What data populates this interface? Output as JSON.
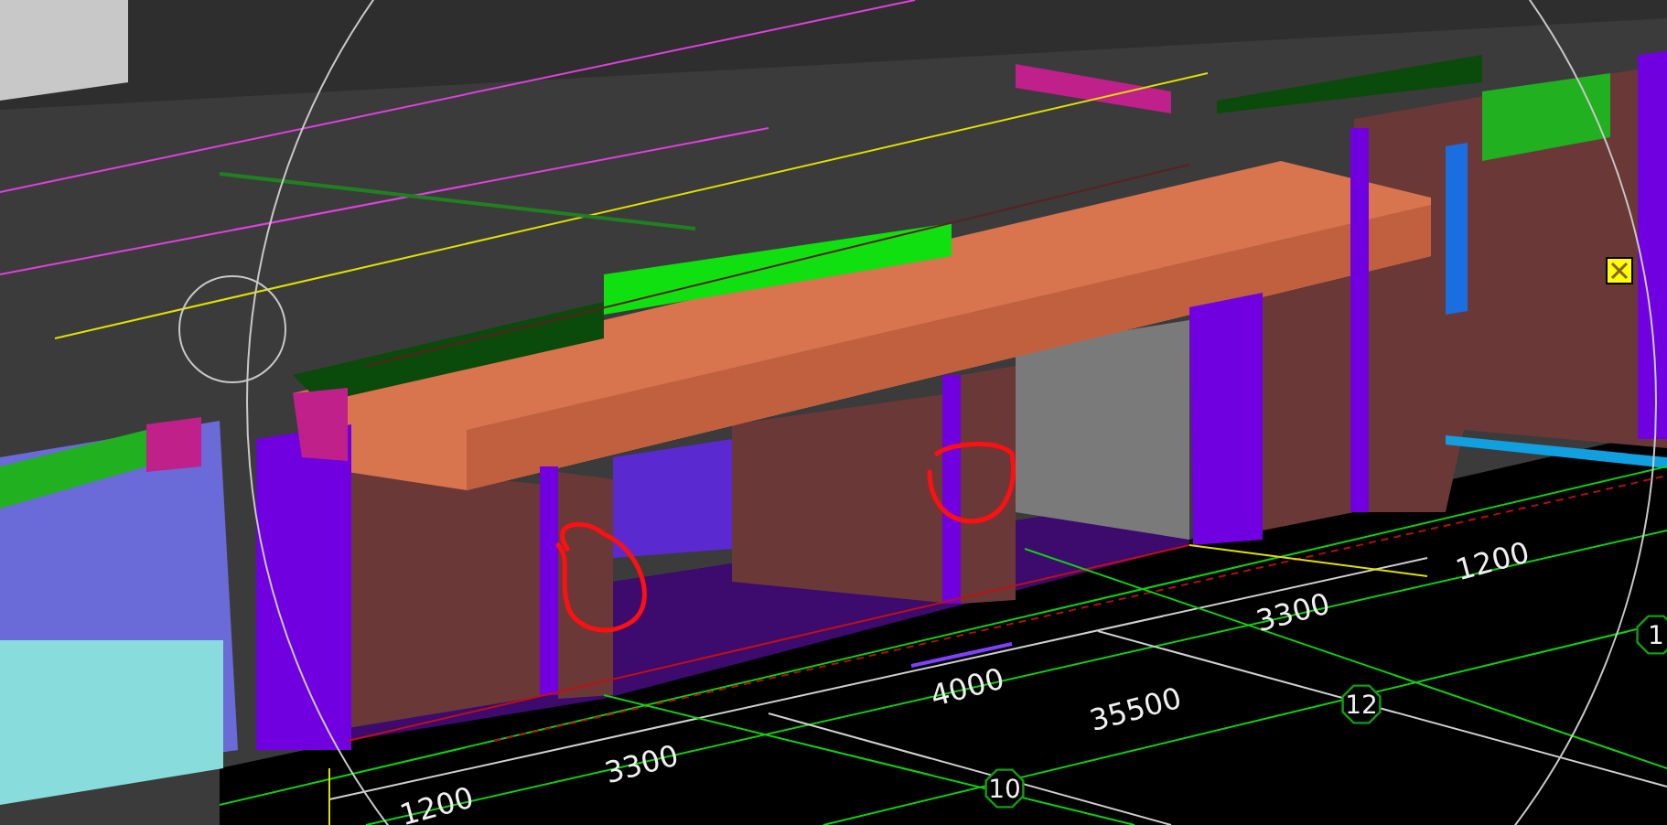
{
  "viewport": {
    "labels": [
      {
        "kind": "dimension",
        "text": "1200"
      },
      {
        "kind": "dimension",
        "text": "3300"
      },
      {
        "kind": "dimension",
        "text": "4000"
      },
      {
        "kind": "dimension",
        "text": "35500"
      },
      {
        "kind": "bubble",
        "text": "12"
      },
      {
        "kind": "dimension",
        "text": "3300"
      },
      {
        "kind": "bubble",
        "text": "10"
      },
      {
        "kind": "dimension",
        "text": "1200"
      },
      {
        "kind": "bubble",
        "text": "1"
      }
    ]
  }
}
